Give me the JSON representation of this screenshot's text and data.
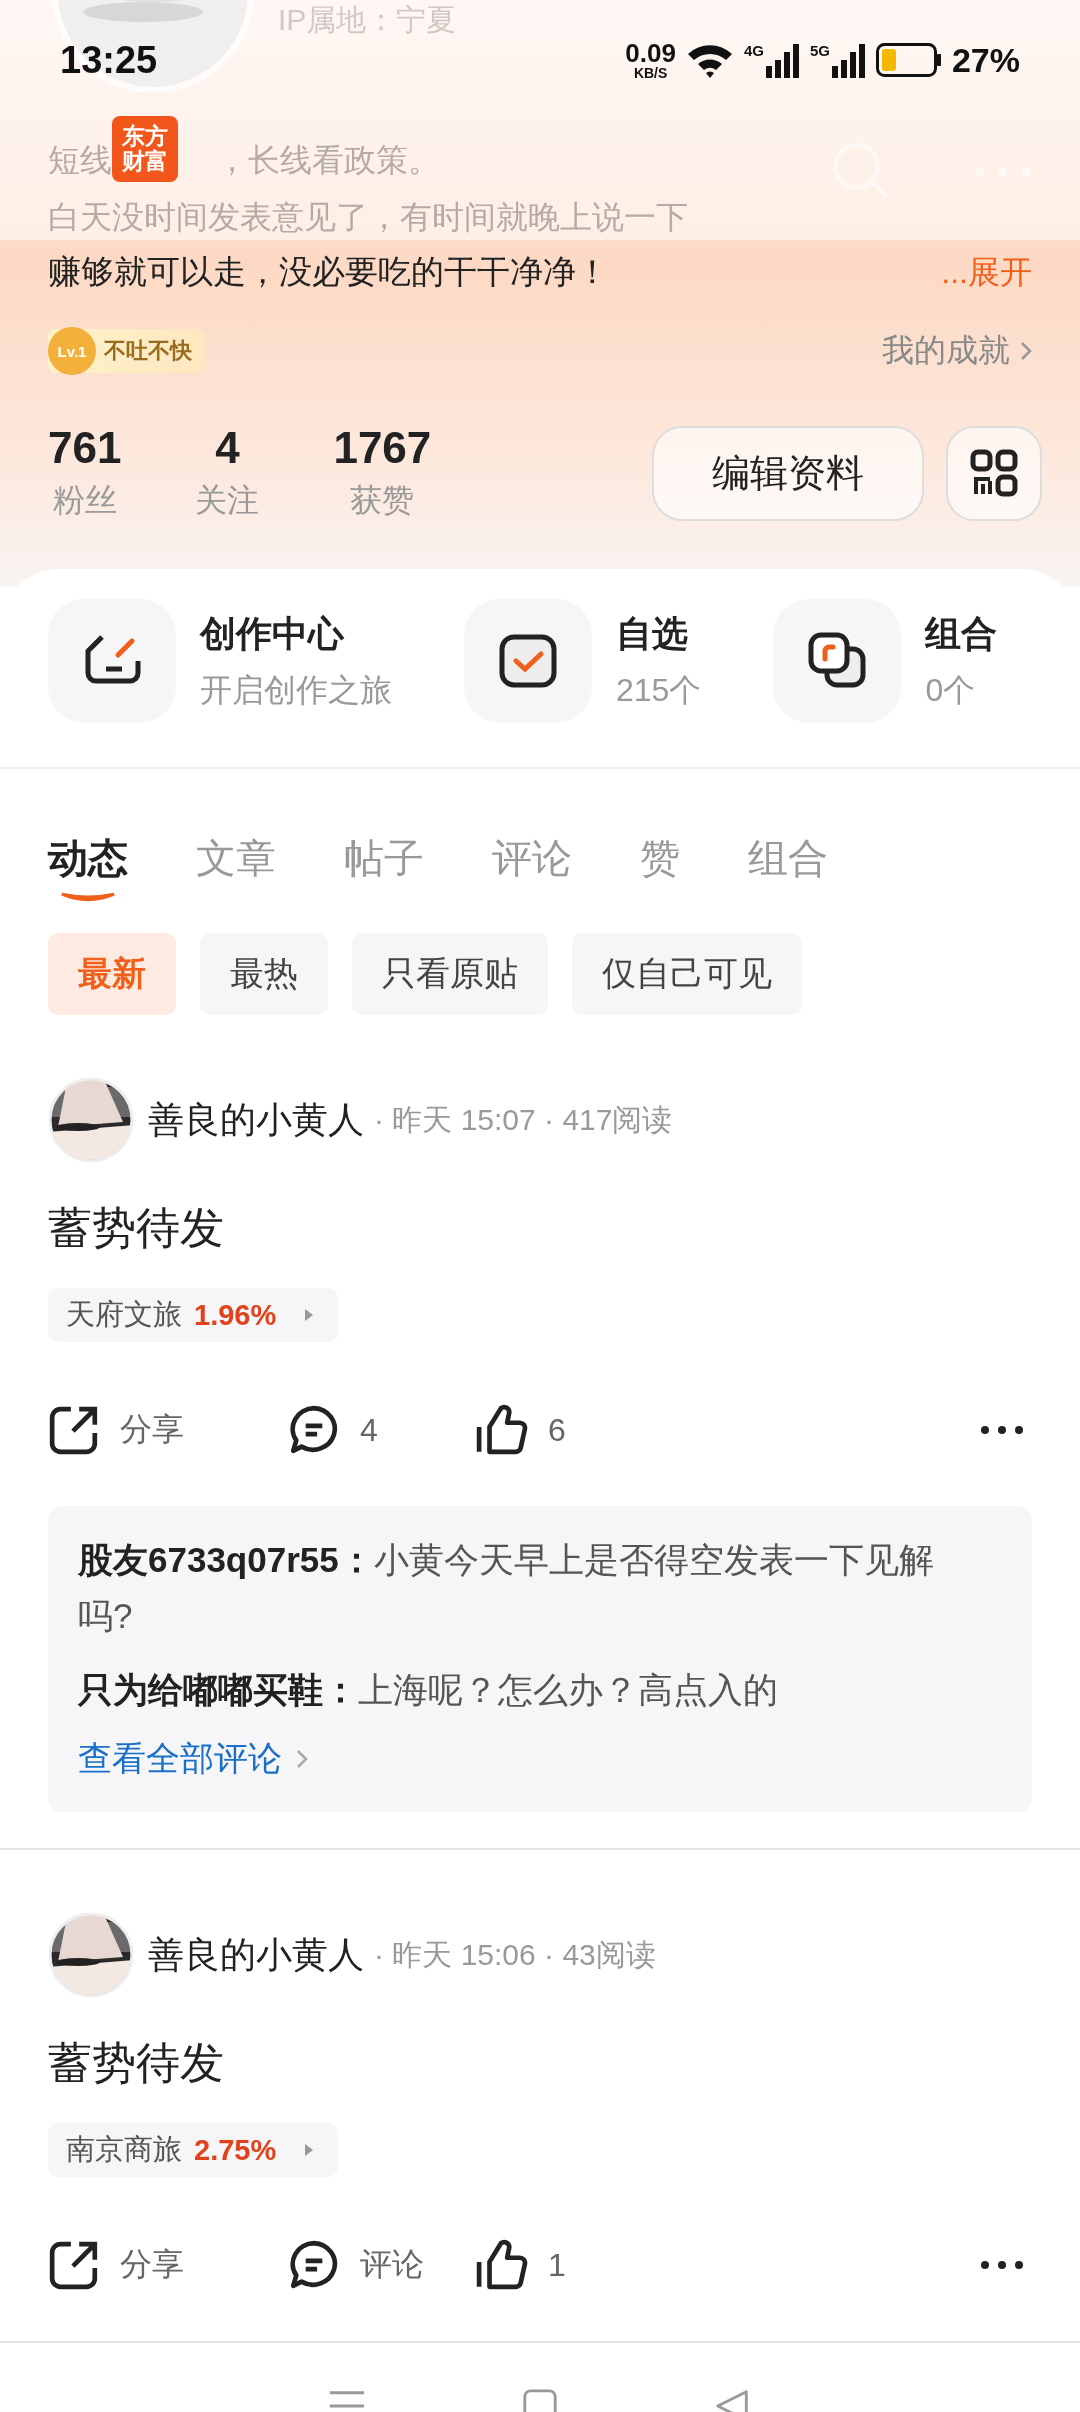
{
  "status_bar": {
    "time": "13:25",
    "net_speed": "0.09",
    "net_unit": "KB/S",
    "signal_1": "4G",
    "signal_2": "5G",
    "battery": "27%"
  },
  "header": {
    "ip_location": "IP属地：宁夏",
    "bio_line_1_start": "短线",
    "bio_line_1_end": "，长线看政策。",
    "bio_line_2": "白天没时间发表意见了，有时间就晚上说一下",
    "bio_line_3": "赚够就可以走，没必要吃的干干净净！",
    "expand": "...展开",
    "app_logo": [
      "东方",
      "财富"
    ]
  },
  "level_badge": {
    "level": "Lv.1",
    "title": "不吐不快"
  },
  "achievements": "我的成就",
  "stats": [
    {
      "value": "761",
      "label": "粉丝"
    },
    {
      "value": "4",
      "label": "关注"
    },
    {
      "value": "1767",
      "label": "获赞"
    }
  ],
  "edit_button": "编辑资料",
  "shortcuts": [
    {
      "kind": "create",
      "title": "创作中心",
      "subtitle": "开启创作之旅"
    },
    {
      "kind": "watchlist",
      "title": "自选",
      "subtitle": "215个"
    },
    {
      "kind": "portfolio",
      "title": "组合",
      "subtitle": "0个"
    }
  ],
  "tabs": [
    {
      "label": "动态",
      "selected": true
    },
    {
      "label": "文章",
      "selected": false
    },
    {
      "label": "帖子",
      "selected": false
    },
    {
      "label": "评论",
      "selected": false
    },
    {
      "label": "赞",
      "selected": false
    },
    {
      "label": "组合",
      "selected": false
    }
  ],
  "filters": [
    {
      "label": "最新",
      "selected": true
    },
    {
      "label": "最热",
      "selected": false
    },
    {
      "label": "只看原贴",
      "selected": false
    },
    {
      "label": "仅自己可见",
      "selected": false
    }
  ],
  "posts": [
    {
      "author": "善良的小黄人",
      "meta": "· 昨天 15:07 · 417阅读",
      "title": "蓄势待发",
      "stock": {
        "name": "天府文旅",
        "change": "1.96%"
      },
      "share": "分享",
      "comment": "4",
      "like": "6",
      "comments": [
        {
          "user": "股友6733q07r55：",
          "text": "小黄今天早上是否得空发表一下见解吗?"
        },
        {
          "user": "只为给嘟嘟买鞋：",
          "text": "上海呢？怎么办？高点入的"
        }
      ],
      "view_all": "查看全部评论"
    },
    {
      "author": "善良的小黄人",
      "meta": "· 昨天 15:06 · 43阅读",
      "title": "蓄势待发",
      "stock": {
        "name": "南京商旅",
        "change": "2.75%"
      },
      "share": "分享",
      "comment": "评论",
      "like": "1"
    }
  ]
}
